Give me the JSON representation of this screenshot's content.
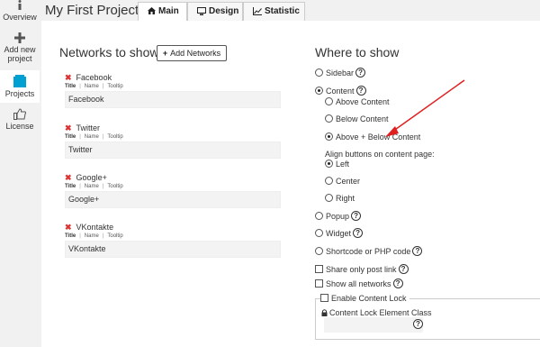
{
  "sidebar": {
    "items": [
      {
        "label": "Overview",
        "icon": "info-icon"
      },
      {
        "label": "Add new project",
        "icon": "plus-icon"
      },
      {
        "label": "Projects",
        "icon": "projects-icon"
      },
      {
        "label": "License",
        "icon": "thumbs-up-icon"
      }
    ]
  },
  "header": {
    "title": "My First Project",
    "tabs": [
      {
        "label": "Main",
        "icon": "home-icon",
        "active": true
      },
      {
        "label": "Design",
        "icon": "monitor-icon",
        "active": false
      },
      {
        "label": "Statistic",
        "icon": "chart-icon",
        "active": false
      }
    ]
  },
  "networks": {
    "heading": "Networks to show",
    "add_button": "Add Networks",
    "sub_title": "Title",
    "sub_name": "Name",
    "sub_tooltip": "Tooltip",
    "items": [
      {
        "name": "Facebook",
        "title": "Facebook"
      },
      {
        "name": "Twitter",
        "title": "Twitter"
      },
      {
        "name": "Google+",
        "title": "Google+"
      },
      {
        "name": "VKontakte",
        "title": "VKontakte"
      }
    ]
  },
  "where": {
    "heading": "Where to show",
    "sidebar": "Sidebar",
    "content": "Content",
    "above_content": "Above Content",
    "below_content": "Below Content",
    "above_below": "Above + Below Content",
    "align_label": "Align buttons on content page:",
    "left": "Left",
    "center": "Center",
    "right": "Right",
    "popup": "Popup",
    "widget": "Widget",
    "shortcode": "Shortcode or PHP code",
    "share_only": "Share only post link",
    "show_all": "Show all networks",
    "enable_lock": "Enable Content Lock",
    "lock_class": "Content Lock Element Class",
    "help": "?"
  },
  "colors": {
    "accent": "#00a0d2",
    "remove": "#dd3333",
    "arrow": "#e02020"
  }
}
